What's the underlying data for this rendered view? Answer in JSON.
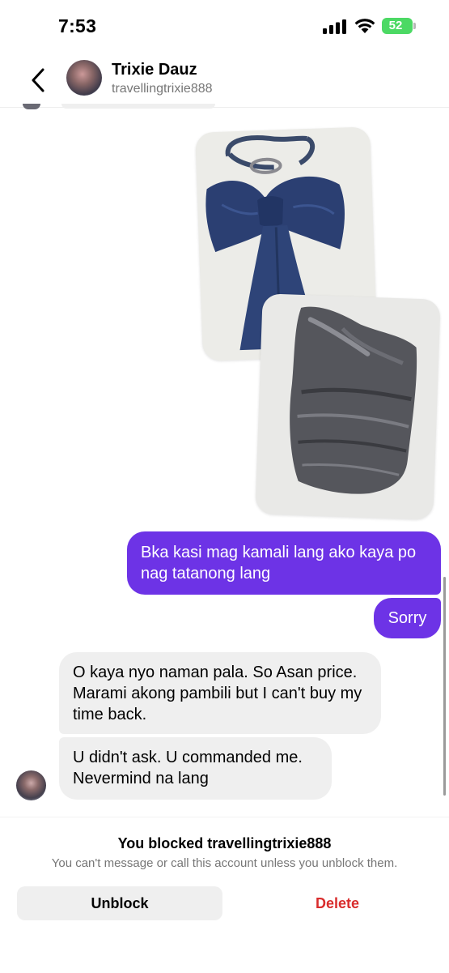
{
  "status_bar": {
    "time": "7:53",
    "battery": "52",
    "icons": [
      "signal-icon",
      "wifi-icon",
      "battery-icon"
    ]
  },
  "header": {
    "name": "Trixie Dauz",
    "username": "travellingtrixie888",
    "back_icon": "chevron-left-icon"
  },
  "photos": [
    {
      "description_icon": "photo-blue-bow-top"
    },
    {
      "description_icon": "photo-gray-draped-top"
    }
  ],
  "messages": [
    {
      "direction": "outgoing",
      "text": "Bka kasi mag kamali lang ako kaya po nag tatanong lang"
    },
    {
      "direction": "outgoing",
      "text": "Sorry"
    },
    {
      "direction": "incoming",
      "text": "O kaya nyo naman pala. So Asan price. Marami akong pambili but I can't buy my time back."
    },
    {
      "direction": "incoming",
      "text": "U didn't ask. U commanded me. Nevermind na lang"
    }
  ],
  "blocked_notice": {
    "title": "You blocked travellingtrixie888",
    "description": "You can't message or call this account unless you unblock them.",
    "unblock_label": "Unblock",
    "delete_label": "Delete"
  },
  "colors": {
    "outgoing_bubble": "#6d33e6",
    "incoming_bubble": "#efefef",
    "delete_text": "#d92d2d",
    "battery": "#4cd964"
  }
}
